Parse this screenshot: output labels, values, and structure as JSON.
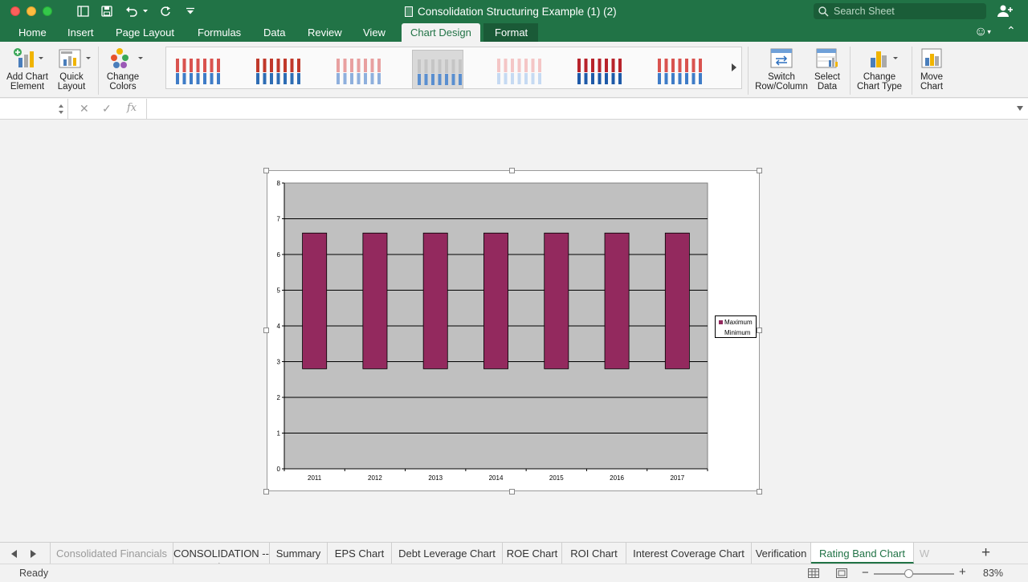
{
  "window": {
    "title": "Consolidation Structuring Example (1) (2)",
    "search_placeholder": "Search Sheet"
  },
  "tabs": {
    "home": "Home",
    "insert": "Insert",
    "page_layout": "Page Layout",
    "formulas": "Formulas",
    "data": "Data",
    "review": "Review",
    "view": "View",
    "chart_design": "Chart Design",
    "format": "Format"
  },
  "ribbon": {
    "add_chart_element": [
      "Add Chart",
      "Element"
    ],
    "quick_layout": [
      "Quick",
      "Layout"
    ],
    "change_colors": [
      "Change",
      "Colors"
    ],
    "switch_row_column": [
      "Switch",
      "Row/Column"
    ],
    "select_data": [
      "Select",
      "Data"
    ],
    "change_chart_type": [
      "Change",
      "Chart Type"
    ],
    "move_chart": [
      "Move",
      "Chart"
    ],
    "chart_styles_count": 7,
    "selected_style_index": 3
  },
  "formula_bar": {
    "fx_label": "fx",
    "name_box": "",
    "formula": ""
  },
  "chart_data": {
    "type": "bar",
    "categories": [
      "2011",
      "2012",
      "2013",
      "2014",
      "2015",
      "2016",
      "2017"
    ],
    "series": [
      {
        "name": "Minimum",
        "values": [
          2.8,
          2.8,
          2.8,
          2.8,
          2.8,
          2.8,
          2.8
        ],
        "color": "transparent"
      },
      {
        "name": "Maximum",
        "values": [
          6.6,
          6.6,
          6.6,
          6.6,
          6.6,
          6.6,
          6.6
        ],
        "color": "#93295e"
      }
    ],
    "stacked_band": true,
    "ylim": [
      0,
      8
    ],
    "yticks": [
      0,
      1,
      2,
      3,
      4,
      5,
      6,
      7,
      8
    ],
    "plot_background": "#c0c0c0",
    "grid": true,
    "legend_position": "right"
  },
  "sheet_tabs": [
    "Consolidated Financials",
    "CONSOLIDATION -->",
    "Summary",
    "EPS Chart",
    "Debt Leverage Chart",
    "ROE Chart",
    "ROI Chart",
    "Interest Coverage Chart",
    "Verification",
    "Rating Band Chart",
    "W"
  ],
  "active_sheet": "Rating Band Chart",
  "status": {
    "ready": "Ready",
    "zoom": "83%",
    "zoom_fraction": 0.43
  },
  "colors": {
    "brand": "#217346",
    "bar": "#93295e",
    "plot_area": "#c0c0c0"
  }
}
